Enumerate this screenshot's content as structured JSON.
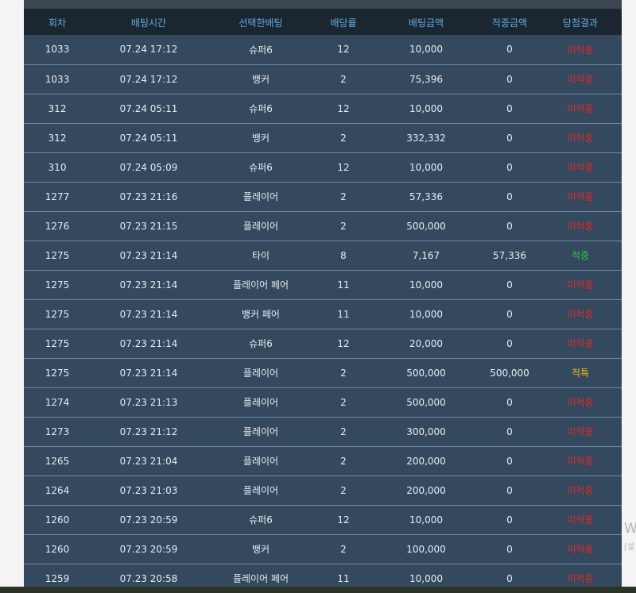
{
  "table": {
    "headers": [
      "회차",
      "배팅시간",
      "선택한배팅",
      "배당률",
      "배팅금액",
      "적중금액",
      "당첨결과"
    ],
    "rows": [
      {
        "round": "1033",
        "time": "07.24 17:12",
        "pick": "슈퍼6",
        "odds": "12",
        "bet": "10,000",
        "win": "0",
        "result": "미적중",
        "status": "lose"
      },
      {
        "round": "1033",
        "time": "07.24 17:12",
        "pick": "뱅커",
        "odds": "2",
        "bet": "75,396",
        "win": "0",
        "result": "미적중",
        "status": "lose"
      },
      {
        "round": "312",
        "time": "07.24 05:11",
        "pick": "슈퍼6",
        "odds": "12",
        "bet": "10,000",
        "win": "0",
        "result": "미적중",
        "status": "lose"
      },
      {
        "round": "312",
        "time": "07.24 05:11",
        "pick": "뱅커",
        "odds": "2",
        "bet": "332,332",
        "win": "0",
        "result": "미적중",
        "status": "lose"
      },
      {
        "round": "310",
        "time": "07.24 05:09",
        "pick": "슈퍼6",
        "odds": "12",
        "bet": "10,000",
        "win": "0",
        "result": "미적중",
        "status": "lose"
      },
      {
        "round": "1277",
        "time": "07.23 21:16",
        "pick": "플레이어",
        "odds": "2",
        "bet": "57,336",
        "win": "0",
        "result": "미적중",
        "status": "lose"
      },
      {
        "round": "1276",
        "time": "07.23 21:15",
        "pick": "플레이어",
        "odds": "2",
        "bet": "500,000",
        "win": "0",
        "result": "미적중",
        "status": "lose"
      },
      {
        "round": "1275",
        "time": "07.23 21:14",
        "pick": "타이",
        "odds": "8",
        "bet": "7,167",
        "win": "57,336",
        "result": "적중",
        "status": "win"
      },
      {
        "round": "1275",
        "time": "07.23 21:14",
        "pick": "플레이어 페어",
        "odds": "11",
        "bet": "10,000",
        "win": "0",
        "result": "미적중",
        "status": "lose"
      },
      {
        "round": "1275",
        "time": "07.23 21:14",
        "pick": "뱅커 페어",
        "odds": "11",
        "bet": "10,000",
        "win": "0",
        "result": "미적중",
        "status": "lose"
      },
      {
        "round": "1275",
        "time": "07.23 21:14",
        "pick": "슈퍼6",
        "odds": "12",
        "bet": "20,000",
        "win": "0",
        "result": "미적중",
        "status": "lose"
      },
      {
        "round": "1275",
        "time": "07.23 21:14",
        "pick": "플레이어",
        "odds": "2",
        "bet": "500,000",
        "win": "500,000",
        "result": "적특",
        "status": "refund"
      },
      {
        "round": "1274",
        "time": "07.23 21:13",
        "pick": "플레이어",
        "odds": "2",
        "bet": "500,000",
        "win": "0",
        "result": "미적중",
        "status": "lose"
      },
      {
        "round": "1273",
        "time": "07.23 21:12",
        "pick": "플레이어",
        "odds": "2",
        "bet": "300,000",
        "win": "0",
        "result": "미적중",
        "status": "lose"
      },
      {
        "round": "1265",
        "time": "07.23 21:04",
        "pick": "플레이어",
        "odds": "2",
        "bet": "200,000",
        "win": "0",
        "result": "미적중",
        "status": "lose"
      },
      {
        "round": "1264",
        "time": "07.23 21:03",
        "pick": "플레이어",
        "odds": "2",
        "bet": "200,000",
        "win": "0",
        "result": "미적중",
        "status": "lose"
      },
      {
        "round": "1260",
        "time": "07.23 20:59",
        "pick": "슈퍼6",
        "odds": "12",
        "bet": "10,000",
        "win": "0",
        "result": "미적중",
        "status": "lose"
      },
      {
        "round": "1260",
        "time": "07.23 20:59",
        "pick": "뱅커",
        "odds": "2",
        "bet": "100,000",
        "win": "0",
        "result": "미적중",
        "status": "lose"
      },
      {
        "round": "1259",
        "time": "07.23 20:58",
        "pick": "플레이어 페어",
        "odds": "11",
        "bet": "10,000",
        "win": "0",
        "result": "미적중",
        "status": "lose"
      }
    ]
  },
  "side": {
    "text": "W",
    "sub": "[설"
  },
  "colors": {
    "header_text": "#5dade2",
    "lose": "#e0282b",
    "win": "#2ecc40",
    "refund": "#f1c40f"
  }
}
